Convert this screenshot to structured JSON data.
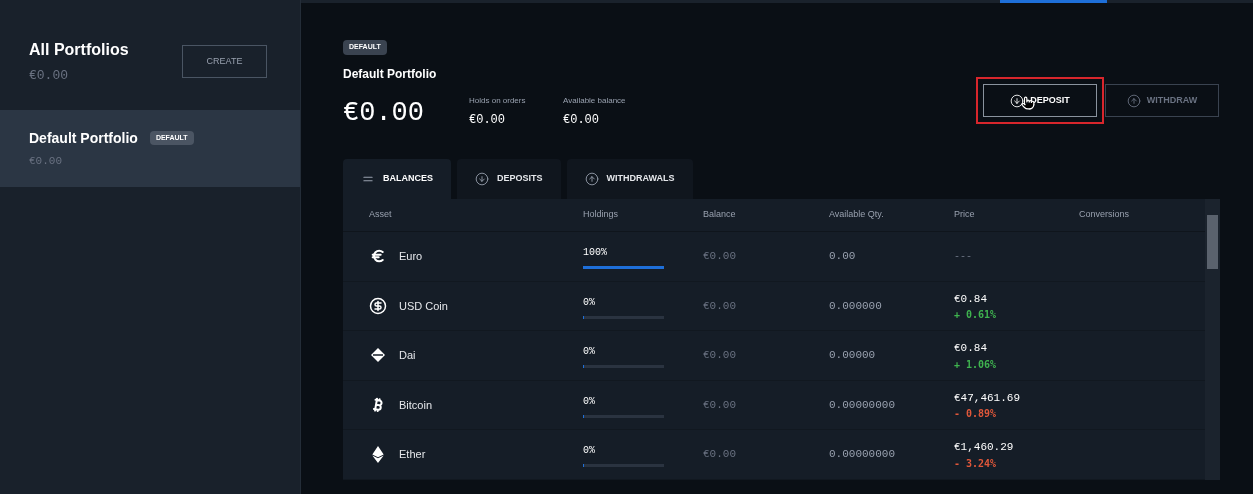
{
  "sidebar": {
    "title": "All Portfolios",
    "total": "€0.00",
    "create_button": "CREATE",
    "portfolios": [
      {
        "name": "Default Portfolio",
        "badge": "DEFAULT",
        "value": "€0.00",
        "selected": true
      }
    ]
  },
  "portfolio": {
    "badge": "DEFAULT",
    "name": "Default Portfolio",
    "total": "€0.00",
    "stats": [
      {
        "label": "Holds on orders",
        "value": "€0.00"
      },
      {
        "label": "Available balance",
        "value": "€0.00"
      }
    ],
    "actions": [
      {
        "kind": "deposit",
        "label": "DEPOSIT",
        "highlighted": true
      },
      {
        "kind": "withdraw",
        "label": "WITHDRAW",
        "highlighted": false
      }
    ]
  },
  "tabs": [
    {
      "kind": "balances",
      "label": "BALANCES",
      "selected": true
    },
    {
      "kind": "deposits",
      "label": "DEPOSITS",
      "selected": false
    },
    {
      "kind": "withdrawals",
      "label": "WITHDRAWALS",
      "selected": false
    }
  ],
  "table": {
    "columns": [
      "Asset",
      "Holdings",
      "Balance",
      "Available Qty.",
      "Price",
      "Conversions"
    ],
    "rows": [
      {
        "kind": "euro",
        "asset": "Euro",
        "holdings": "100%",
        "level": 1,
        "balance": "€0.00",
        "available": "0.00",
        "price": "---"
      },
      {
        "kind": "usd-coin",
        "asset": "USD Coin",
        "holdings": "0%",
        "level": 0,
        "balance": "€0.00",
        "available": "0.000000",
        "price": "€0.84",
        "change": "+ 0.61%",
        "color": "#3fb34f"
      },
      {
        "kind": "dai",
        "asset": "Dai",
        "holdings": "0%",
        "level": 0,
        "balance": "€0.00",
        "available": "0.00000",
        "price": "€0.84",
        "change": "+ 1.06%",
        "color": "#3fb34f"
      },
      {
        "kind": "bitcoin",
        "asset": "Bitcoin",
        "holdings": "0%",
        "level": 0,
        "balance": "€0.00",
        "available": "0.00000000",
        "price": "€47,461.69",
        "change": "- 0.89%",
        "color": "#e0573a"
      },
      {
        "kind": "ether",
        "asset": "Ether",
        "holdings": "0%",
        "level": 0,
        "balance": "€0.00",
        "available": "0.00000000",
        "price": "€1,460.29",
        "change": "- 3.24%",
        "color": "#e0573a"
      }
    ]
  }
}
